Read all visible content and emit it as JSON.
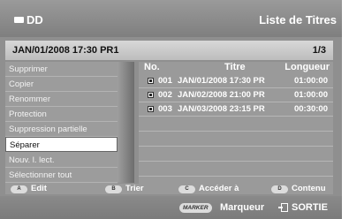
{
  "header": {
    "device_label": "DD",
    "screen_title": "Liste de Titres"
  },
  "info_bar": {
    "current_title": "JAN/01/2008 17:30 PR1",
    "page": "1/3"
  },
  "menu": {
    "items": [
      {
        "label": "Supprimer"
      },
      {
        "label": "Copier"
      },
      {
        "label": "Renommer"
      },
      {
        "label": "Protection"
      },
      {
        "label": "Suppression partielle"
      },
      {
        "label": "Séparer",
        "selected": true
      },
      {
        "label": "Nouv. l. lect."
      },
      {
        "label": "Sélectionner tout"
      }
    ]
  },
  "table": {
    "columns": [
      "No.",
      "Titre",
      "Longueur"
    ],
    "rows": [
      {
        "num": "001",
        "title": "JAN/01/2008 17:30 PR",
        "length": "01:00:00"
      },
      {
        "num": "002",
        "title": "JAN/02/2008 21:00 PR",
        "length": "01:00:00"
      },
      {
        "num": "003",
        "title": "JAN/03/2008 23:15 PR",
        "length": "00:30:00"
      }
    ]
  },
  "color_buttons": [
    {
      "key": "A",
      "label": "Edit"
    },
    {
      "key": "B",
      "label": "Trier"
    },
    {
      "key": "C",
      "label": "Accéder à"
    },
    {
      "key": "D",
      "label": "Contenu"
    }
  ],
  "bottom_bar": {
    "marker_key": "MARKER",
    "marker_label": "Marqueur",
    "exit_label": "SORTIE"
  }
}
